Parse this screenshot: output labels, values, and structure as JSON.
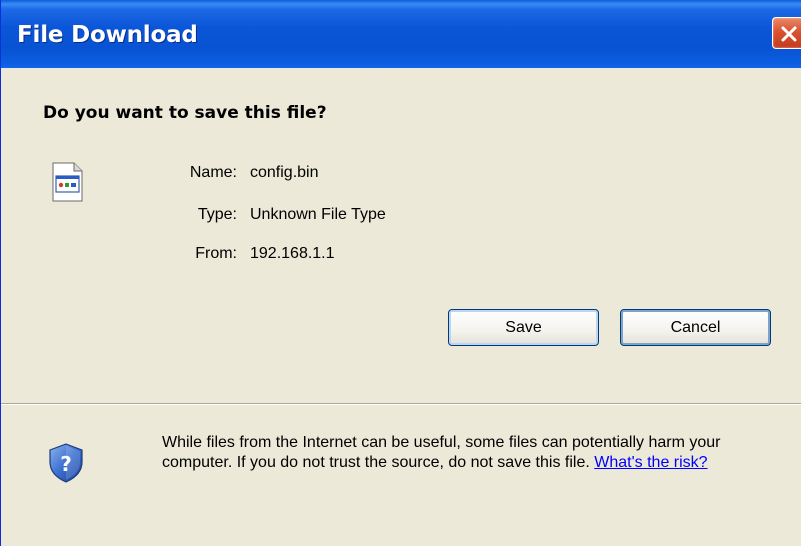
{
  "window": {
    "title": "File Download",
    "close_icon": "close-icon"
  },
  "dialog": {
    "question": "Do you want to save this file?",
    "file_icon": "file-icon",
    "file": {
      "name_label": "Name:",
      "name_value": "config.bin",
      "type_label": "Type:",
      "type_value": "Unknown File Type",
      "from_label": "From:",
      "from_value": "192.168.1.1"
    },
    "buttons": {
      "save": "Save",
      "cancel": "Cancel"
    }
  },
  "warning": {
    "icon": "shield-question-icon",
    "text": "While files from the Internet can be useful, some files can potentially harm your computer. If you do not trust the source, do not save this file.",
    "link": "What's the risk?"
  },
  "colors": {
    "titlebar": "#0a56d8",
    "dialog_background": "#ece9d8",
    "close_button": "#d9532f",
    "link": "#0000ff"
  }
}
